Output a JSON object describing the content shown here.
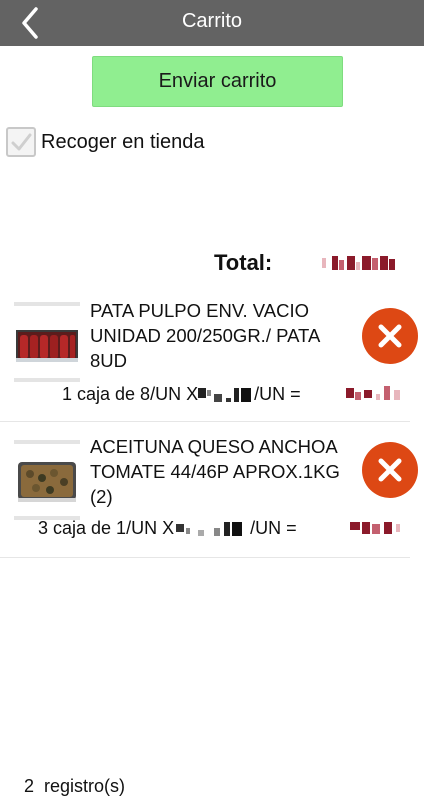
{
  "header": {
    "title": "Carrito",
    "back_icon": "chevron-left-icon"
  },
  "actions": {
    "send_cart_label": "Enviar carrito"
  },
  "pickup": {
    "label": "Recoger en tienda",
    "checked": true
  },
  "summary": {
    "total_label": "Total:"
  },
  "items": [
    {
      "name": "PATA PULPO ENV. VACIO UNIDAD 200/250GR./ PATA 8UD",
      "qty_prefix": "1 caja de 8/UN X",
      "qty_suffix": "/UN ="
    },
    {
      "name": "ACEITUNA QUESO ANCHOA TOMATE 44/46P APROX.1KG (2)",
      "qty_prefix": "3 caja de 1/UN X",
      "qty_suffix": "/UN ="
    }
  ],
  "footer": {
    "count": "2",
    "count_label": "registro(s)"
  },
  "colors": {
    "header_bg": "#636363",
    "send_button_bg": "#90ee90",
    "delete_button_bg": "#dd4814",
    "redacted_price": "#8b1a2a"
  }
}
